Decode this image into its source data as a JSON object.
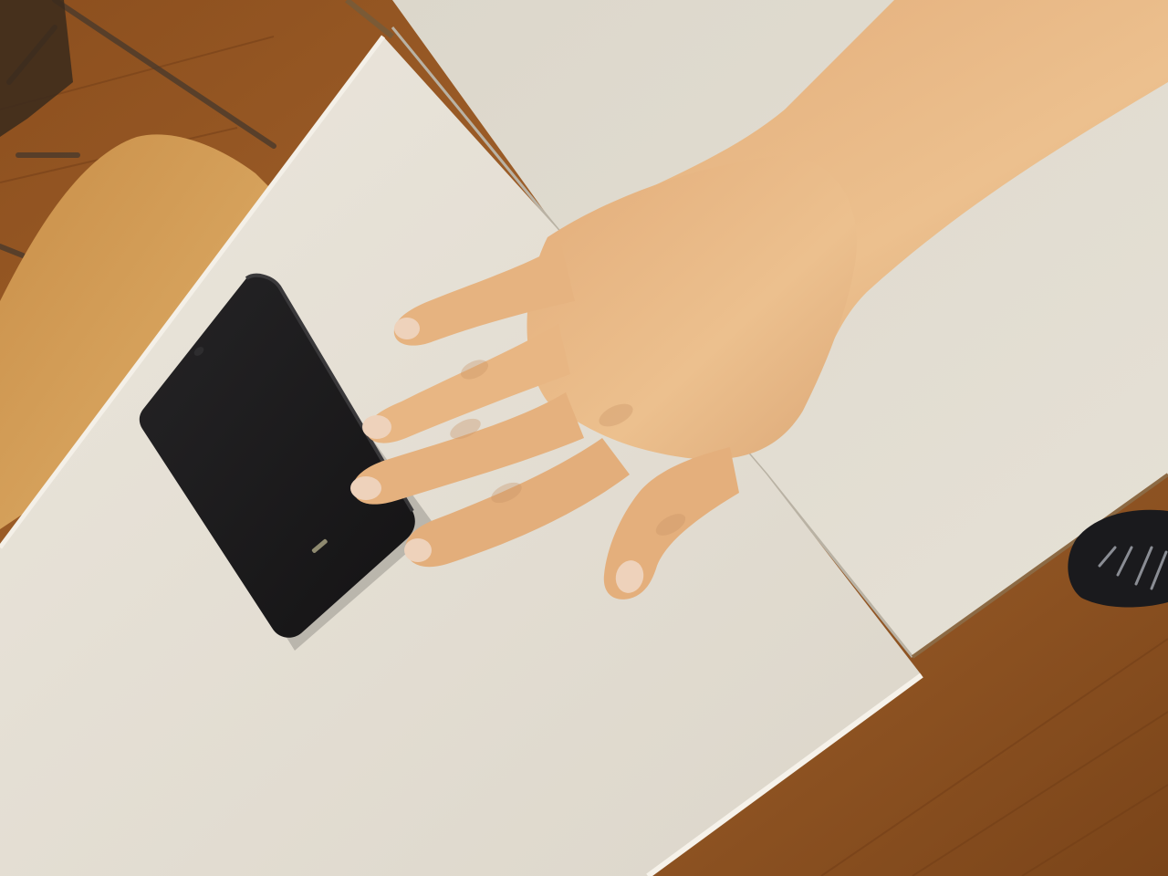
{
  "scene": {
    "subjects": [
      "hand",
      "smartphone",
      "table",
      "chair",
      "floor",
      "shoe"
    ]
  },
  "colors": {
    "floor": "#9a5a26",
    "floor_dark": "#6e3b16",
    "table_main": "#e8e3d8",
    "table_back": "#d9d4c8",
    "table_edge": "#f3efe6",
    "chair_seat": "#d8a85e",
    "phone_body": "#1c1b1c",
    "phone_highlight": "#3a393b",
    "skin": "#e9b984",
    "skin_shadow": "#c99466",
    "skin_light": "#f2cc9c",
    "nail": "#eed2bb",
    "shoe": "#1a1a1d",
    "shoe_lace": "#8a8d94"
  }
}
